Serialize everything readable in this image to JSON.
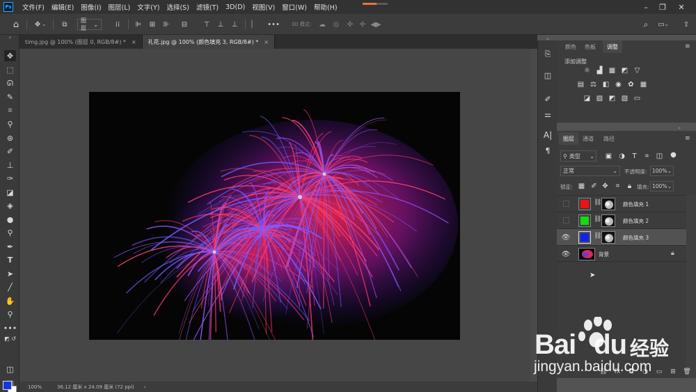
{
  "menubar": {
    "logo": "Ps",
    "items": [
      "文件(F)",
      "编辑(E)",
      "图像(I)",
      "图层(L)",
      "文字(Y)",
      "选择(S)",
      "滤镜(T)",
      "3D(D)",
      "视图(V)",
      "窗口(W)",
      "帮助(H)"
    ],
    "progress": 0.55
  },
  "options": {
    "layer_select": "图层",
    "mode_label": "3D 模式:"
  },
  "tabs": [
    {
      "label": "timg.jpg @ 100% (图层 0, RGB/8#) *",
      "close": "×"
    },
    {
      "label": "礼花.jpg @ 100% (颜色填充 3, RGB/8#) *",
      "close": "×"
    }
  ],
  "status": {
    "zoom": "100%",
    "doc_size": "36.12 厘米 x 24.09 厘米 (72 ppi)",
    "arrow": "›"
  },
  "adjust_panel": {
    "tabs": [
      "颜色",
      "色板",
      "调整"
    ],
    "title": "添加调整"
  },
  "layers_panel": {
    "tabs": [
      "图层",
      "通道",
      "路径"
    ],
    "filter_kind": "类型",
    "blend_mode": "正常",
    "opacity_label": "不透明度:",
    "opacity_value": "100%",
    "lock_label": "锁定:",
    "fill_label": "填充:",
    "fill_value": "100%",
    "layers": [
      {
        "name": "颜色填充 1",
        "color": "#ee1111",
        "visible": false,
        "selected": false
      },
      {
        "name": "颜色填充 2",
        "color": "#11dd11",
        "visible": false,
        "selected": false
      },
      {
        "name": "颜色填充 3",
        "color": "#1122ee",
        "visible": true,
        "selected": true
      },
      {
        "name": "背景",
        "visible": true,
        "selected": false,
        "locked": true
      }
    ]
  },
  "colors": {
    "foreground": "#1535e0",
    "background": "#ffffff"
  },
  "watermark": {
    "brand": "Bai",
    "brand2": "du",
    "cn": "经验",
    "url": "jingyan.baidu.com"
  }
}
